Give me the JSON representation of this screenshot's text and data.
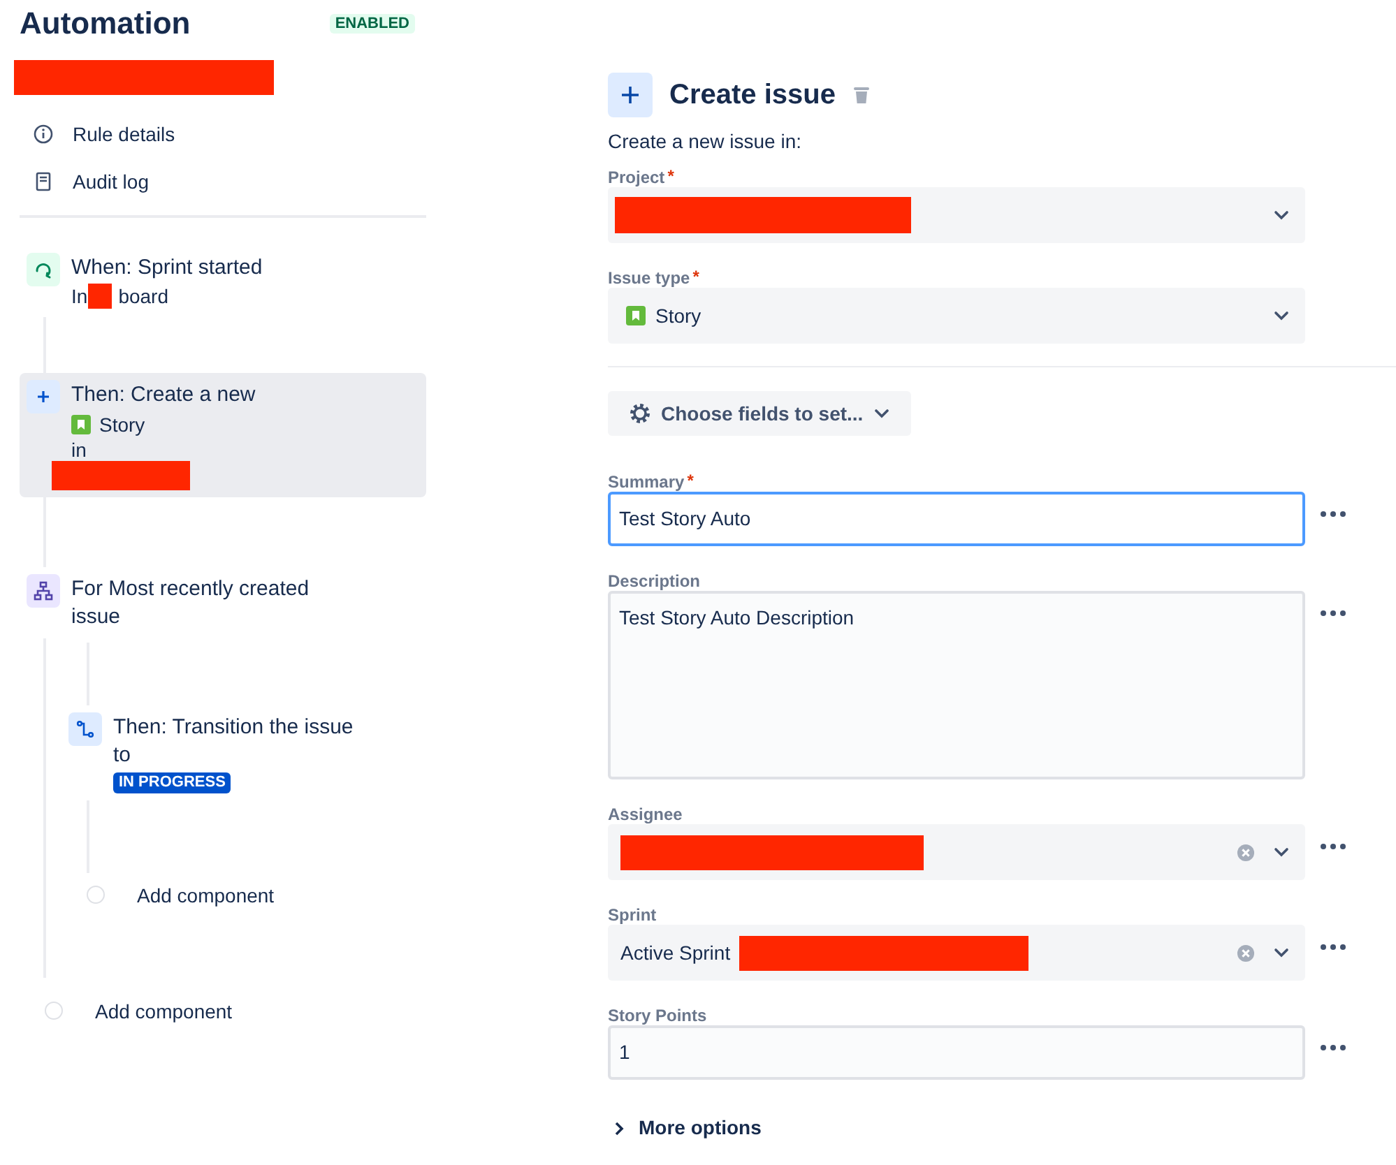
{
  "header": {
    "title": "Automation",
    "status": "ENABLED"
  },
  "nav": [
    {
      "label": "Rule details",
      "kind": "info"
    },
    {
      "label": "Audit log",
      "kind": "log"
    }
  ],
  "flow": [
    {
      "kind": "trigger",
      "title": "When: Sprint started",
      "prefix": "In",
      "suffix": "board",
      "selected": false
    },
    {
      "kind": "action",
      "title": "Then: Create a new",
      "issue_type": "Story",
      "line": "in",
      "selected": true
    },
    {
      "kind": "branch",
      "title": "For Most recently created issue",
      "selected": false,
      "children": [
        {
          "kind": "transition",
          "title": "Then: Transition the issue to",
          "status": "IN PROGRESS",
          "selected": false
        },
        {
          "kind": "add",
          "title": "Add component",
          "selected": false
        }
      ]
    },
    {
      "kind": "add",
      "title": "Add component",
      "selected": false
    }
  ],
  "editor": {
    "title": "Create issue",
    "intro": "Create a new issue in:",
    "target_fields": [
      {
        "label": "Project",
        "required_mark": "*",
        "redacted": true,
        "story_icon": false
      },
      {
        "label": "Issue type",
        "required_mark": "*",
        "value": "Story",
        "redacted": false,
        "story_icon": true
      }
    ],
    "choose_button": "Choose fields to set...",
    "fields": [
      {
        "kind": "text",
        "label": "Summary",
        "required_mark": "*",
        "value": "Test Story Auto",
        "focused": true
      },
      {
        "kind": "textarea",
        "label": "Description",
        "value": "Test Story Auto Description",
        "focused": false
      },
      {
        "kind": "select",
        "label": "Assignee",
        "redacted": true,
        "clearable": true
      },
      {
        "kind": "select",
        "label": "Sprint",
        "value": "Active Sprint",
        "redacted": true,
        "clearable": true
      },
      {
        "kind": "text",
        "label": "Story Points",
        "value": "1",
        "focused": false
      }
    ],
    "more_options": "More options"
  }
}
